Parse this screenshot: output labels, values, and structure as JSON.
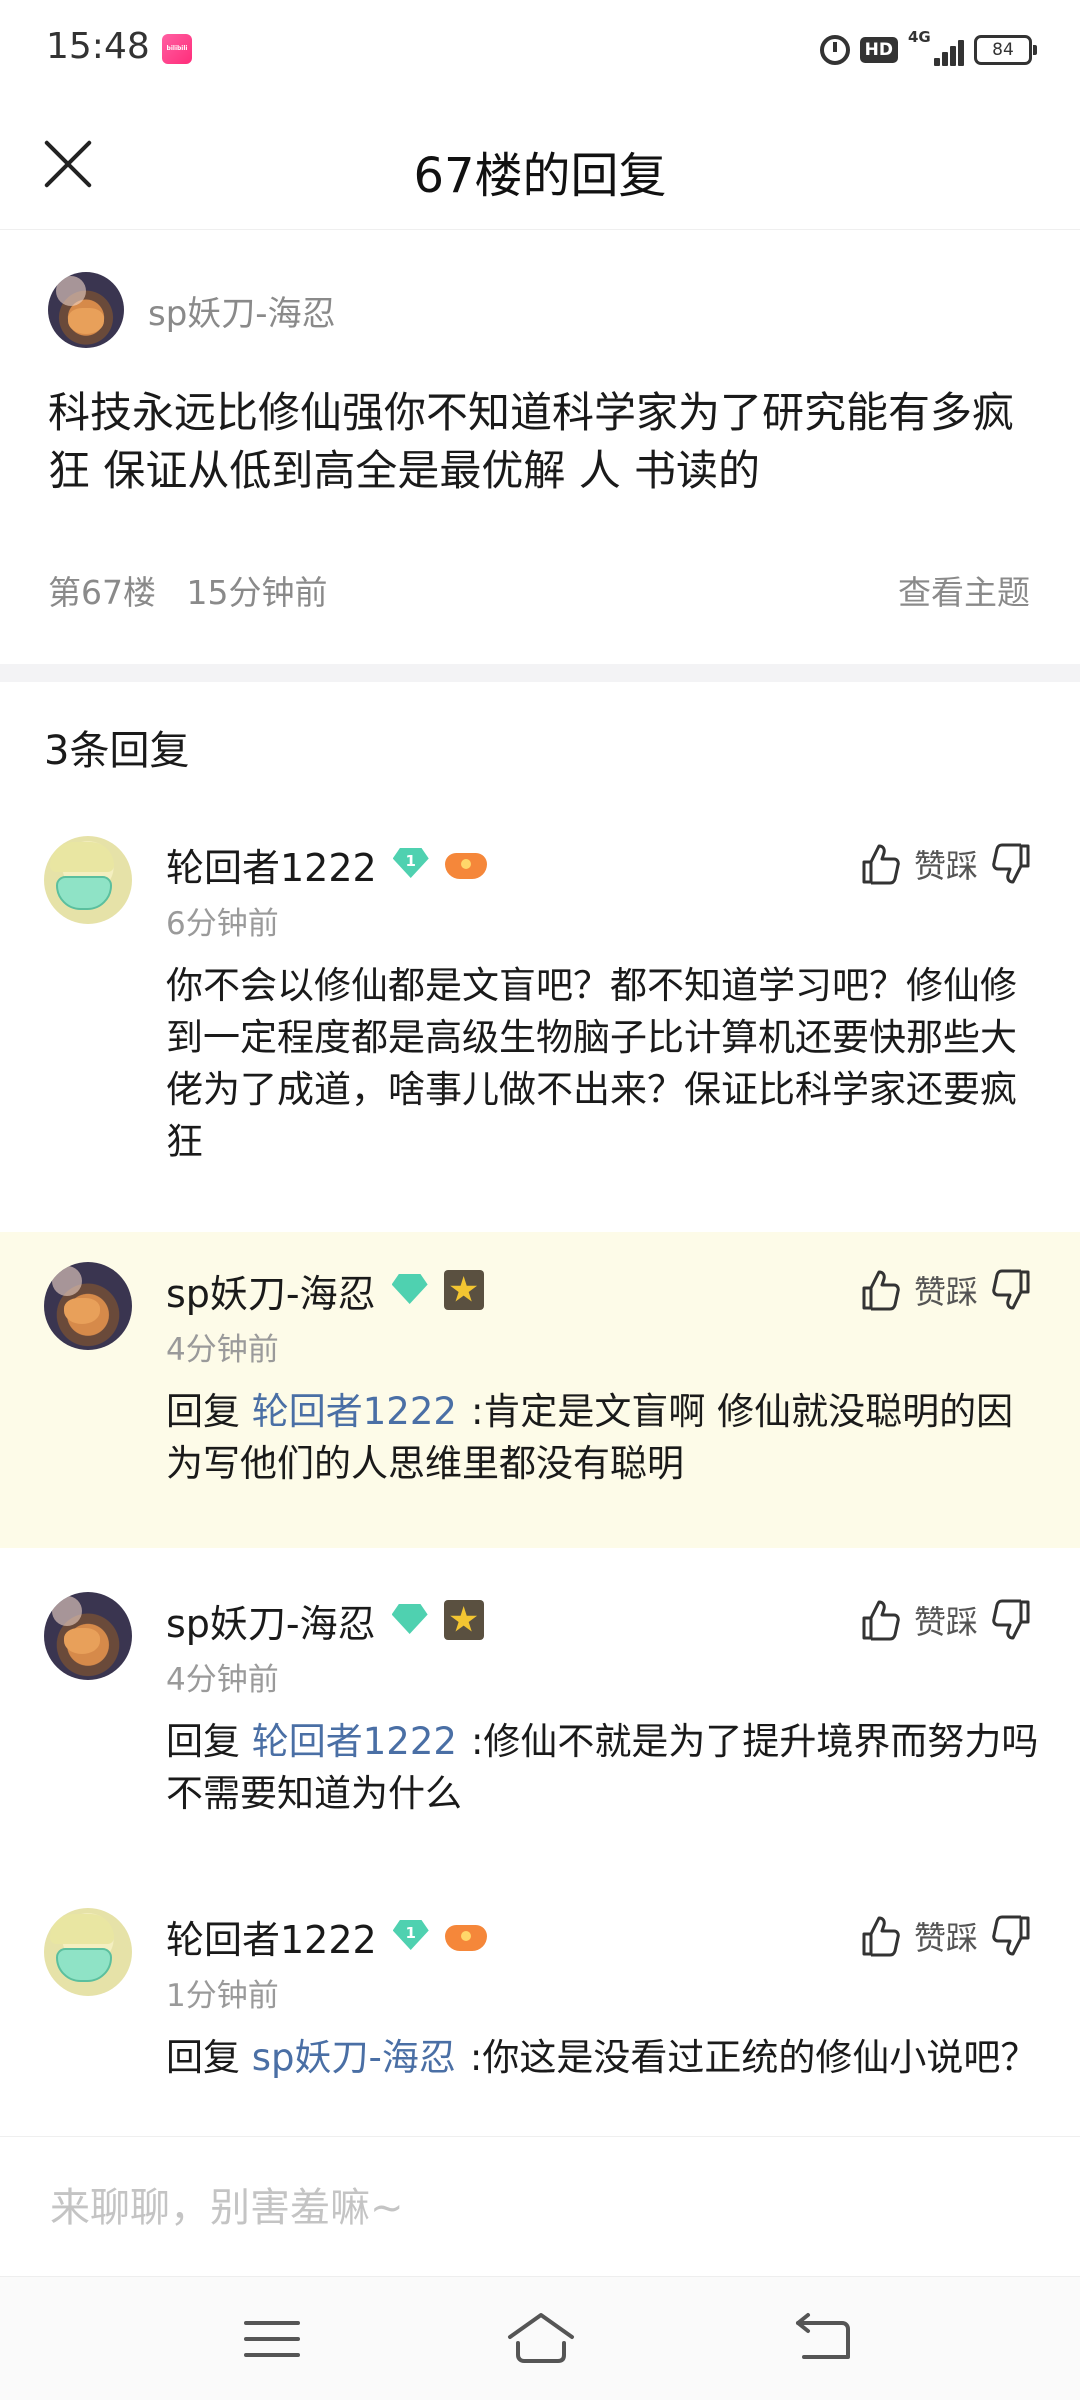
{
  "status_bar": {
    "time": "15:48",
    "app_badge": "bilibili",
    "hd": "HD",
    "network": "4G",
    "battery": "84"
  },
  "header": {
    "title": "67楼的回复"
  },
  "main_post": {
    "author": "sp妖刀-海忍",
    "content": "科技永远比修仙强你不知道科学家为了研究能有多疯狂 保证从低到高全是最优解 人 书读的",
    "floor": "第67楼",
    "time": "15分钟前",
    "view_topic": "查看主题"
  },
  "replies_header": "3条回复",
  "vote_label": "赞踩",
  "replies": [
    {
      "author": "轮回者1222",
      "level": "1",
      "time": "6分钟前",
      "text": "你不会以修仙都是文盲吧？都不知道学习吧？修仙修到一定程度都是高级生物脑子比计算机还要快那些大佬为了成道，啥事儿做不出来？保证比科学家还要疯狂"
    },
    {
      "author": "sp妖刀-海忍",
      "time": "4分钟前",
      "reply_prefix": "回复",
      "mention": "轮回者1222",
      "text": ":肯定是文盲啊 修仙就没聪明的因为写他们的人思维里都没有聪明"
    },
    {
      "author": "sp妖刀-海忍",
      "time": "4分钟前",
      "reply_prefix": "回复",
      "mention": "轮回者1222",
      "text": ":修仙不就是为了提升境界而努力吗不需要知道为什么"
    },
    {
      "author": "轮回者1222",
      "level": "1",
      "time": "1分钟前",
      "reply_prefix": "回复",
      "mention": "sp妖刀-海忍",
      "text": ":你这是没看过正统的修仙小说吧？"
    }
  ],
  "input": {
    "placeholder": "来聊聊，别害羞嘛~"
  }
}
